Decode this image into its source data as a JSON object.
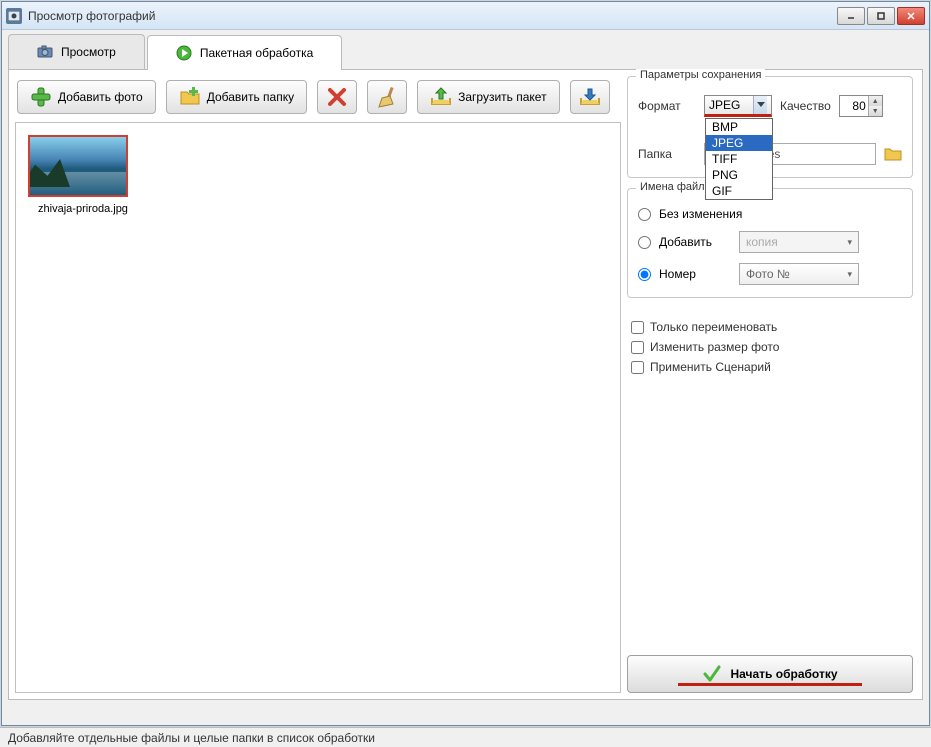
{
  "window": {
    "title": "Просмотр фотографий"
  },
  "tabs": {
    "view": "Просмотр",
    "batch": "Пакетная обработка"
  },
  "toolbar": {
    "add_photo": "Добавить фото",
    "add_folder": "Добавить папку",
    "load_batch": "Загрузить пакет"
  },
  "thumb": {
    "name": "zhivaja-priroda.jpg"
  },
  "save_params": {
    "title": "Параметры сохранения",
    "format_label": "Формат",
    "format_value": "JPEG",
    "format_options": [
      "BMP",
      "JPEG",
      "TIFF",
      "PNG",
      "GIF"
    ],
    "quality_label": "Качество",
    "quality_value": "80",
    "folder_label": "Папка",
    "folder_value": "ublic\\Pictures"
  },
  "filenames": {
    "title": "Имена файлов",
    "unchanged": "Без изменения",
    "append": "Добавить",
    "append_value": "копия",
    "number": "Номер",
    "number_value": "Фото №"
  },
  "checks": {
    "rename_only": "Только переименовать",
    "resize": "Изменить размер фото",
    "scenario": "Применить Сценарий"
  },
  "start_button": "Начать обработку",
  "status": "Добавляйте отдельные файлы и целые папки в список обработки"
}
